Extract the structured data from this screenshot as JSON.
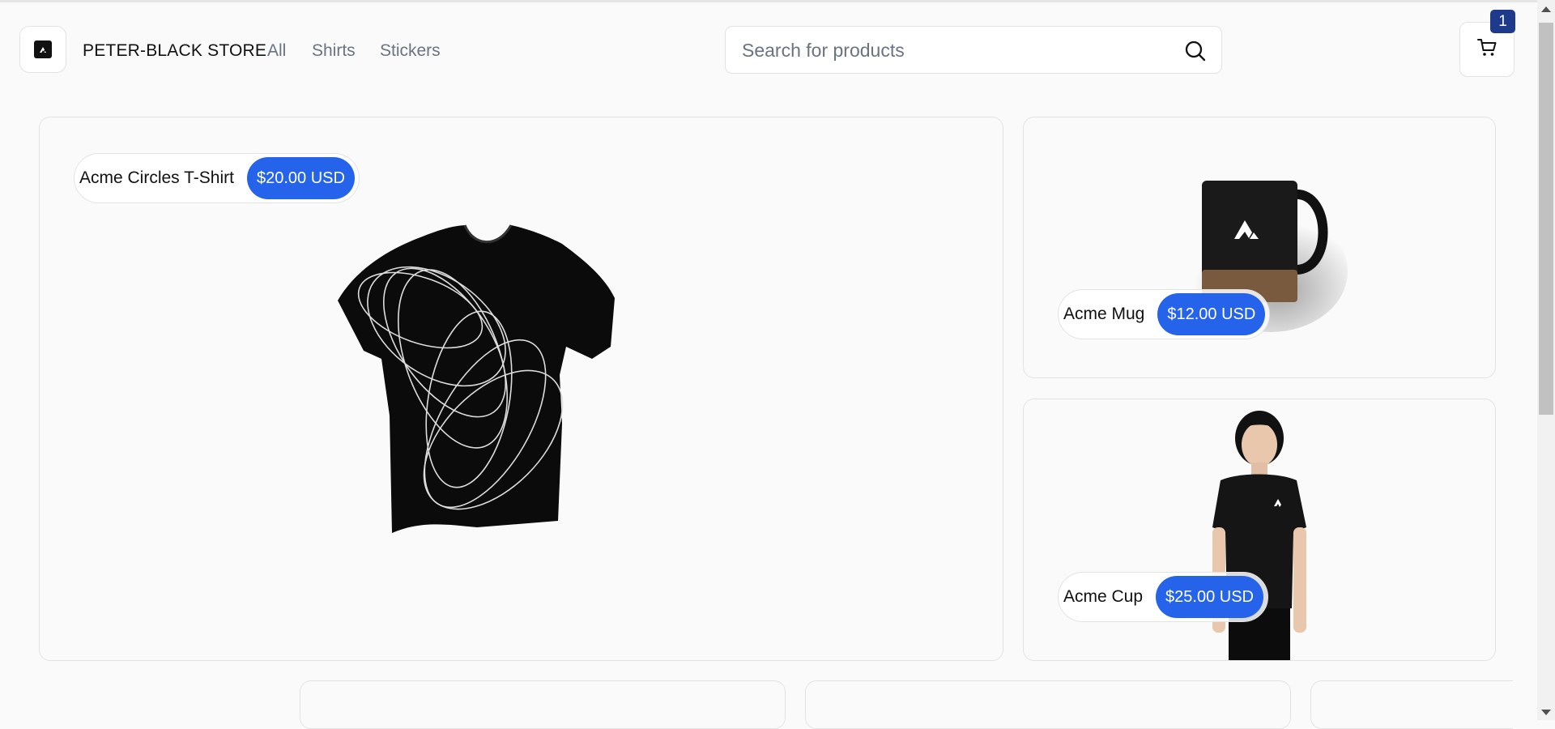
{
  "header": {
    "brand": "PETER-BLACK STORE",
    "nav": [
      {
        "label": "All"
      },
      {
        "label": "Shirts"
      },
      {
        "label": "Stickers"
      }
    ],
    "search": {
      "placeholder": "Search for products",
      "value": ""
    },
    "cart": {
      "count": "1",
      "icon": "cart-icon"
    }
  },
  "products": [
    {
      "name": "Acme Circles T-Shirt",
      "price": "$20.00 USD"
    },
    {
      "name": "Acme Mug",
      "price": "$12.00 USD"
    },
    {
      "name": "Acme Cup",
      "price": "$25.00 USD"
    }
  ],
  "colors": {
    "accent": "#2563eb",
    "badge": "#1e3a8a"
  }
}
